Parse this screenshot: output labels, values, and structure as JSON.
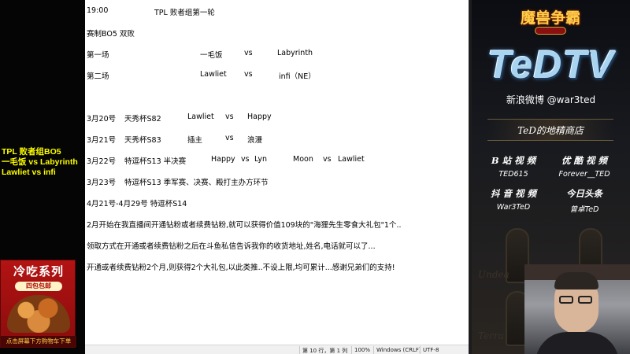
{
  "stream_overlay": {
    "match_lines": [
      "TPL 败者组BO5",
      "一毛饭 vs Labyrinth",
      "Lawliet vs infi"
    ],
    "promo": {
      "title": "冷吃系列",
      "badge": "四包包邮",
      "footer": "点击屏幕下方购物车下单"
    }
  },
  "document": {
    "header": {
      "time": "19:00",
      "event": "TPL  败者组第一轮"
    },
    "format": "赛制BO5  双败",
    "matches": [
      {
        "label": "第一场",
        "p1": "一毛饭",
        "vs": "vs",
        "p2": "Labyrinth"
      },
      {
        "label": "第二场",
        "p1": "Lawliet",
        "vs": "vs",
        "p2": "infi（NE）"
      }
    ],
    "schedule": [
      {
        "date": "3月20号",
        "event": "天秀杯S82",
        "p1": "Lawliet",
        "vs": "vs",
        "p2": "Happy"
      },
      {
        "date": "3月21号",
        "event": "天秀杯S83",
        "p1": "插主",
        "vs": "vs",
        "p2": "浪漫"
      }
    ],
    "row_322": {
      "date": "3月22号",
      "event": "特逗杯S13  半决赛",
      "m1p1": "Happy",
      "m1vs": "vs",
      "m1p2": "Lyn",
      "m2p1": "Moon",
      "m2vs": "vs",
      "m2p2": "Lawliet"
    },
    "row_323": {
      "date": "3月23号",
      "event": "特逗杯S13  季军赛、决赛、殿打主办方环节"
    },
    "row_421": "4月21号-4月29号  特逗杯S14",
    "para1": "2月开始在我直播间开通钻粉或者续费钻粉,就可以获得价值109块的\"海狸先生零食大礼包\"1个..",
    "para2": "领取方式在开通或者续费钻粉之后在斗鱼私信告诉我你的收货地址,姓名,电话就可以了...",
    "para3": "开通或者续费钻粉2个月,则获得2个大礼包,以此类推..不设上限,均可累计...感谢兄弟们的支持!"
  },
  "statusbar": {
    "position": "第 10 行，第 1 列",
    "zoom": "100%",
    "line_ending": "Windows (CRLF)",
    "encoding": "UTF-8"
  },
  "right_panel": {
    "game_logo": "魔兽争霸",
    "brand": "TeDTV",
    "weibo": "新浪微博 @war3ted",
    "shop": "TeD的地精商店",
    "social": [
      {
        "title": "B 站 视 频",
        "handle": "TED615"
      },
      {
        "title": "优 酷 视 频",
        "handle": "Forever__TED"
      },
      {
        "title": "抖 音 视 频",
        "handle": "War3TeD"
      },
      {
        "title": "今日头条",
        "handle": "曾卓TeD"
      }
    ],
    "watermark_1": "Undea",
    "watermark_2": "Terra"
  }
}
